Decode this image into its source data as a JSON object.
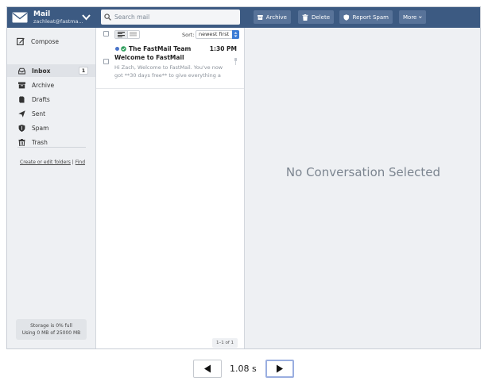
{
  "account": {
    "name": "Mail",
    "email": "zachleat@fastma..."
  },
  "search": {
    "placeholder": "Search mail",
    "value": ""
  },
  "toolbar": {
    "archive_label": "Archive",
    "delete_label": "Delete",
    "spam_label": "Report Spam",
    "more_label": "More"
  },
  "sidebar": {
    "compose_label": "Compose",
    "folders": [
      {
        "label": "Inbox",
        "icon": "inbox-icon",
        "count": "1",
        "active": true
      },
      {
        "label": "Archive",
        "icon": "archive-icon"
      },
      {
        "label": "Drafts",
        "icon": "drafts-icon"
      },
      {
        "label": "Sent",
        "icon": "sent-icon"
      },
      {
        "label": "Spam",
        "icon": "spam-shield-icon"
      },
      {
        "label": "Trash",
        "icon": "trash-icon"
      }
    ],
    "edit_folders_link": "Create or edit folders",
    "separator": "|",
    "find_link": "Find",
    "storage_line1": "Storage is 0% full",
    "storage_line2": "Using 0 MB of 25000 MB"
  },
  "list": {
    "sort_label": "Sort:",
    "sort_value": "newest first",
    "messages": [
      {
        "from": "The FastMail Team",
        "time": "1:30 PM",
        "subject": "Welcome to FastMail",
        "preview": "Hi Zach, Welcome to FastMail. You've now got **30 days free** to give everything a",
        "unread": true
      }
    ],
    "count_text": "1–1 of 1"
  },
  "reading_pane": {
    "empty_text": "No Conversation Selected"
  },
  "player": {
    "time": "1.08 s"
  },
  "colors": {
    "topbar": "#3c5a82",
    "toolbar_button": "#587399",
    "sidebar_bg": "#eef0f3",
    "accent_blue": "#3a7bd5",
    "unread_dot": "#4a74c9",
    "verified": "#2e9e5b"
  }
}
